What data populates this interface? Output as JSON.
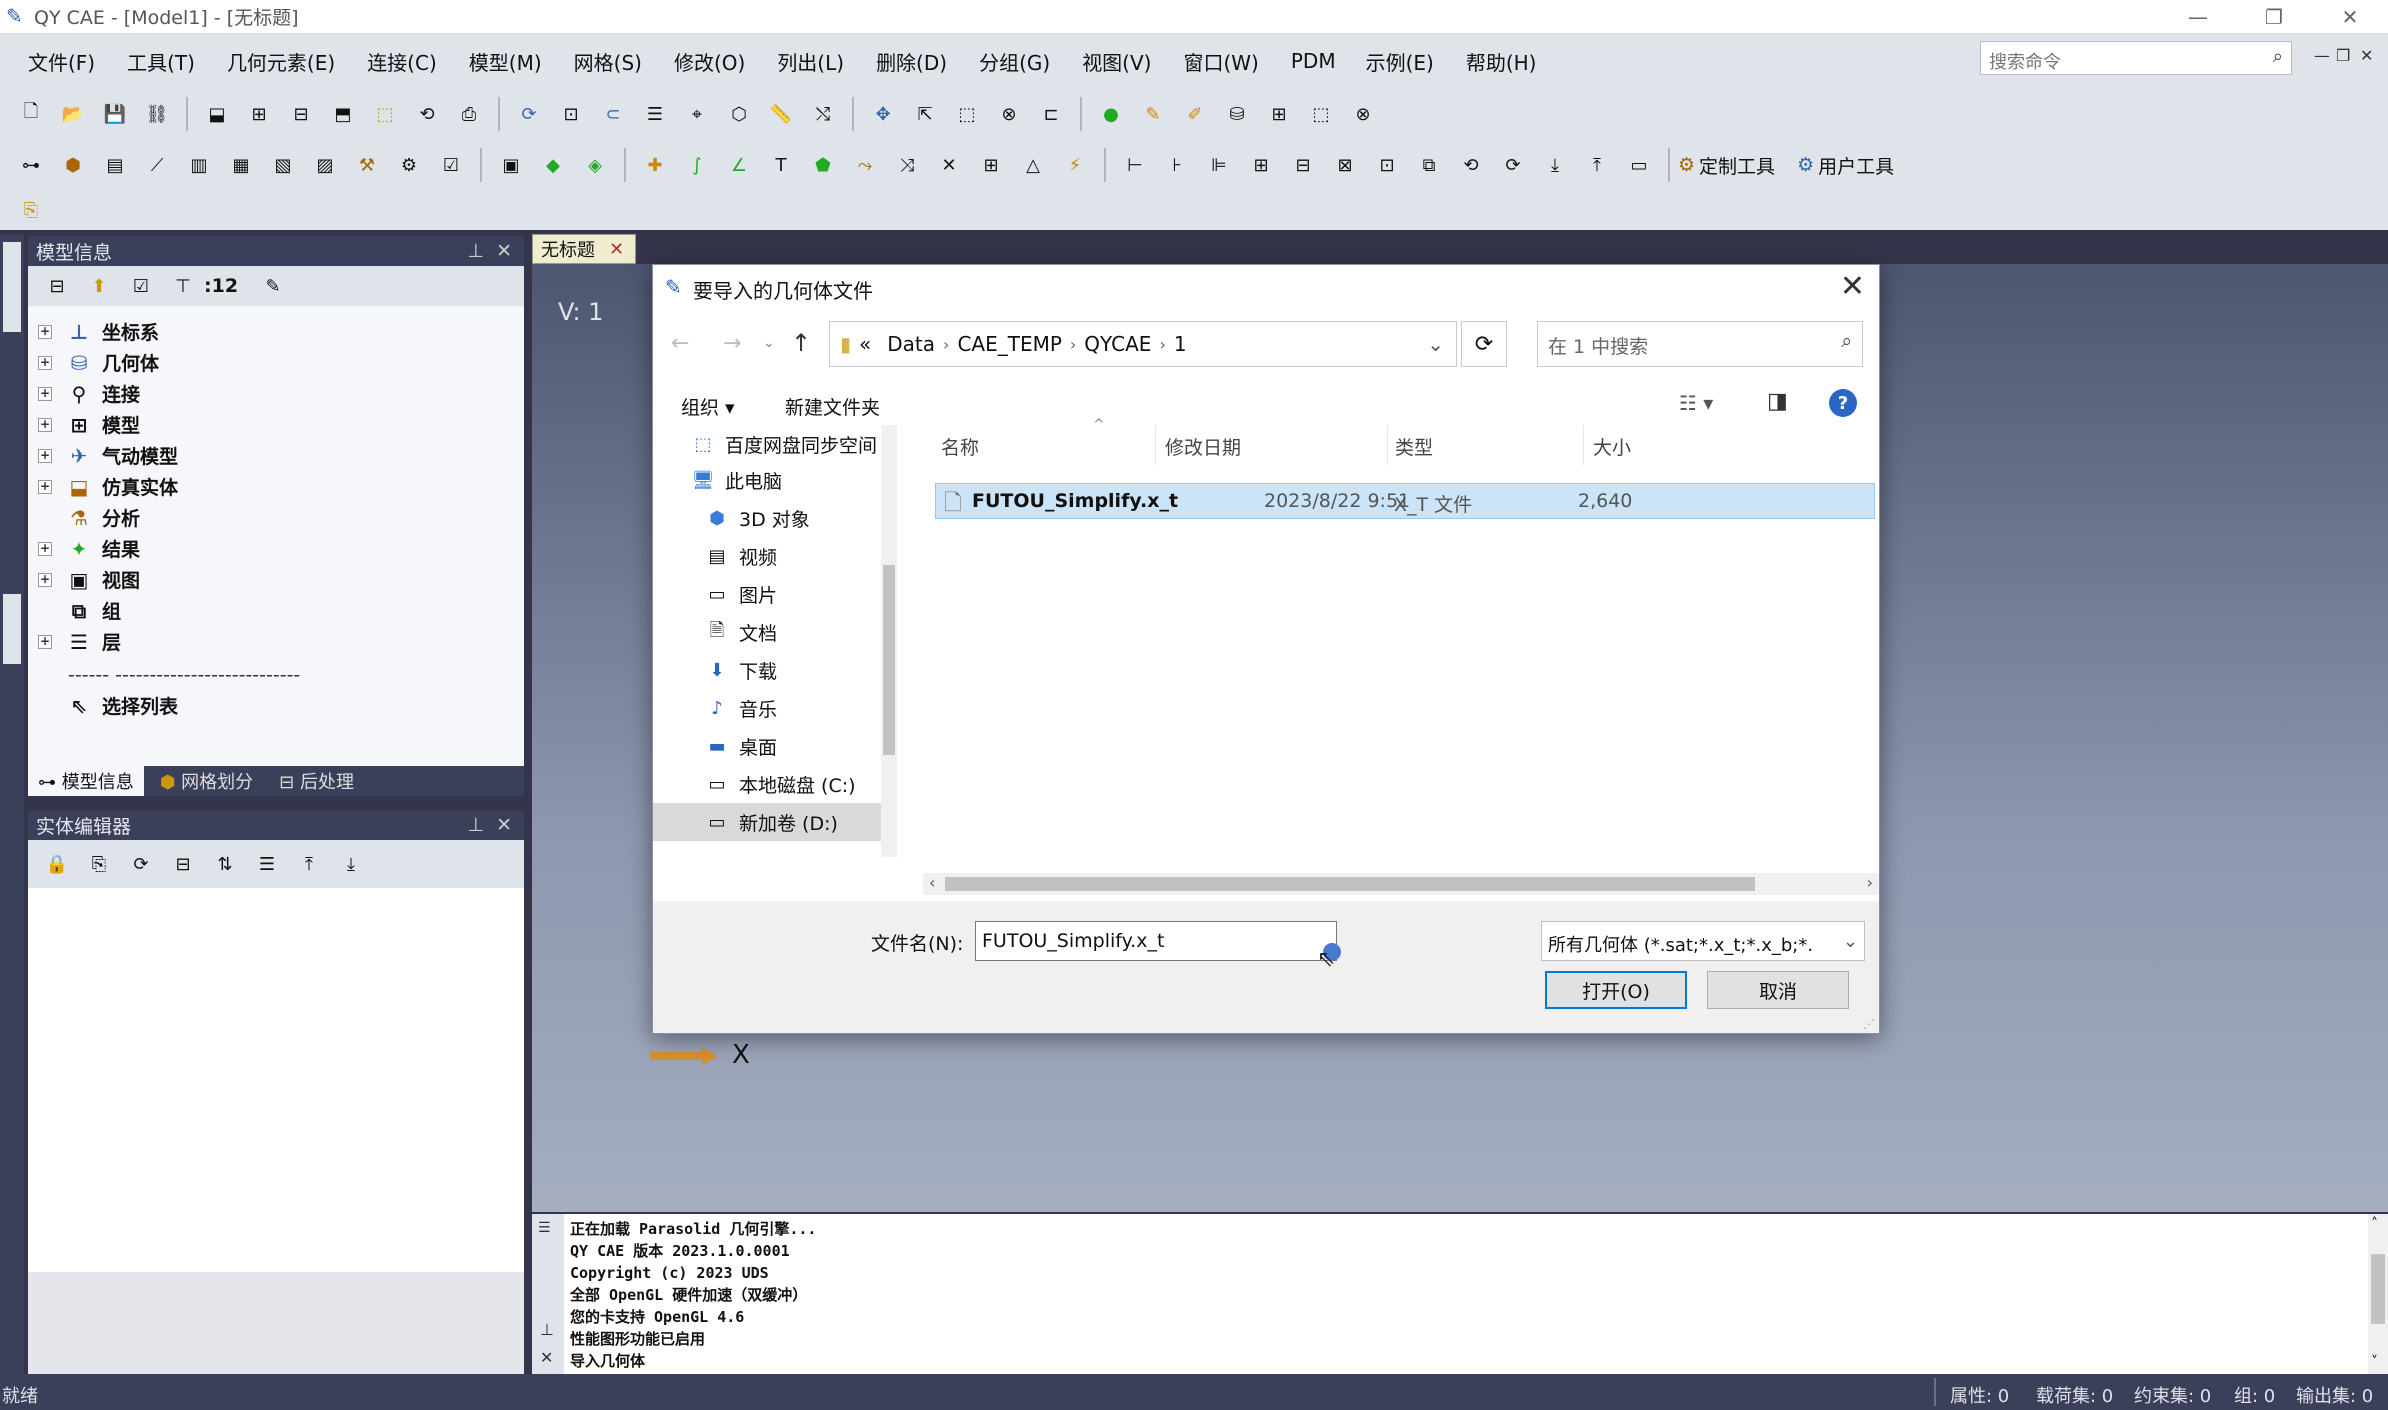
{
  "window": {
    "title": "QY CAE - [Model1] - [无标题]"
  },
  "menu": [
    "文件(F)",
    "工具(T)",
    "几何元素(E)",
    "连接(C)",
    "模型(M)",
    "网格(S)",
    "修改(O)",
    "列出(L)",
    "删除(D)",
    "分组(G)",
    "视图(V)",
    "窗口(W)",
    "PDM",
    "示例(E)",
    "帮助(H)"
  ],
  "command_search": {
    "placeholder": "搜索命令"
  },
  "toolbar": {
    "custom_tools": "定制工具",
    "user_tools": "用户工具"
  },
  "model_panel": {
    "title": "模型信息",
    "count": ":12",
    "tree": [
      "坐标系",
      "几何体",
      "连接",
      "模型",
      "气动模型",
      "仿真实体",
      "分析",
      "结果",
      "视图",
      "组",
      "层"
    ],
    "separator": "------ ---------------------------",
    "selection_list": "选择列表",
    "tabs": [
      "模型信息",
      "网格划分",
      "后处理"
    ]
  },
  "entity_panel": {
    "title": "实体编辑器"
  },
  "document_tab": {
    "label": "无标题"
  },
  "viewport": {
    "view_label": "V: 1",
    "axis_label": "X"
  },
  "dialog": {
    "title": "要导入的几何体文件",
    "path": [
      "Data",
      "CAE_TEMP",
      "QYCAE",
      "1"
    ],
    "path_prefix": "«",
    "search_placeholder": "在 1 中搜索",
    "organize": "组织 ▾",
    "new_folder": "新建文件夹",
    "nav": [
      "百度网盘同步空间",
      "此电脑",
      "3D 对象",
      "视频",
      "图片",
      "文档",
      "下载",
      "音乐",
      "桌面",
      "本地磁盘 (C:)",
      "新加卷 (D:)"
    ],
    "columns": [
      "名称",
      "修改日期",
      "类型",
      "大小"
    ],
    "file": {
      "name": "FUTOU_Simplify.x_t",
      "date": "2023/8/22 9:51",
      "type": "X_T 文件",
      "size": "2,640"
    },
    "filename_label": "文件名(N):",
    "filename_value": "FUTOU_Simplify.x_t",
    "filter": "所有几何体 (*.sat;*.x_t;*.x_b;*.",
    "open": "打开(O)",
    "cancel": "取消"
  },
  "console": [
    "正在加载 Parasolid 几何引擎...",
    "QY CAE 版本 2023.1.0.0001",
    "Copyright (c) 2023 UDS",
    "全部 OpenGL 硬件加速（双缓冲）",
    "您的卡支持 OpenGL 4.6",
    "性能图形功能已启用",
    "导入几何体"
  ],
  "status": {
    "ready": "就绪",
    "attr": "属性: 0",
    "loadset": "载荷集: 0",
    "constraint": "约束集: 0",
    "group": "组: 0",
    "output": "输出集: 0"
  }
}
